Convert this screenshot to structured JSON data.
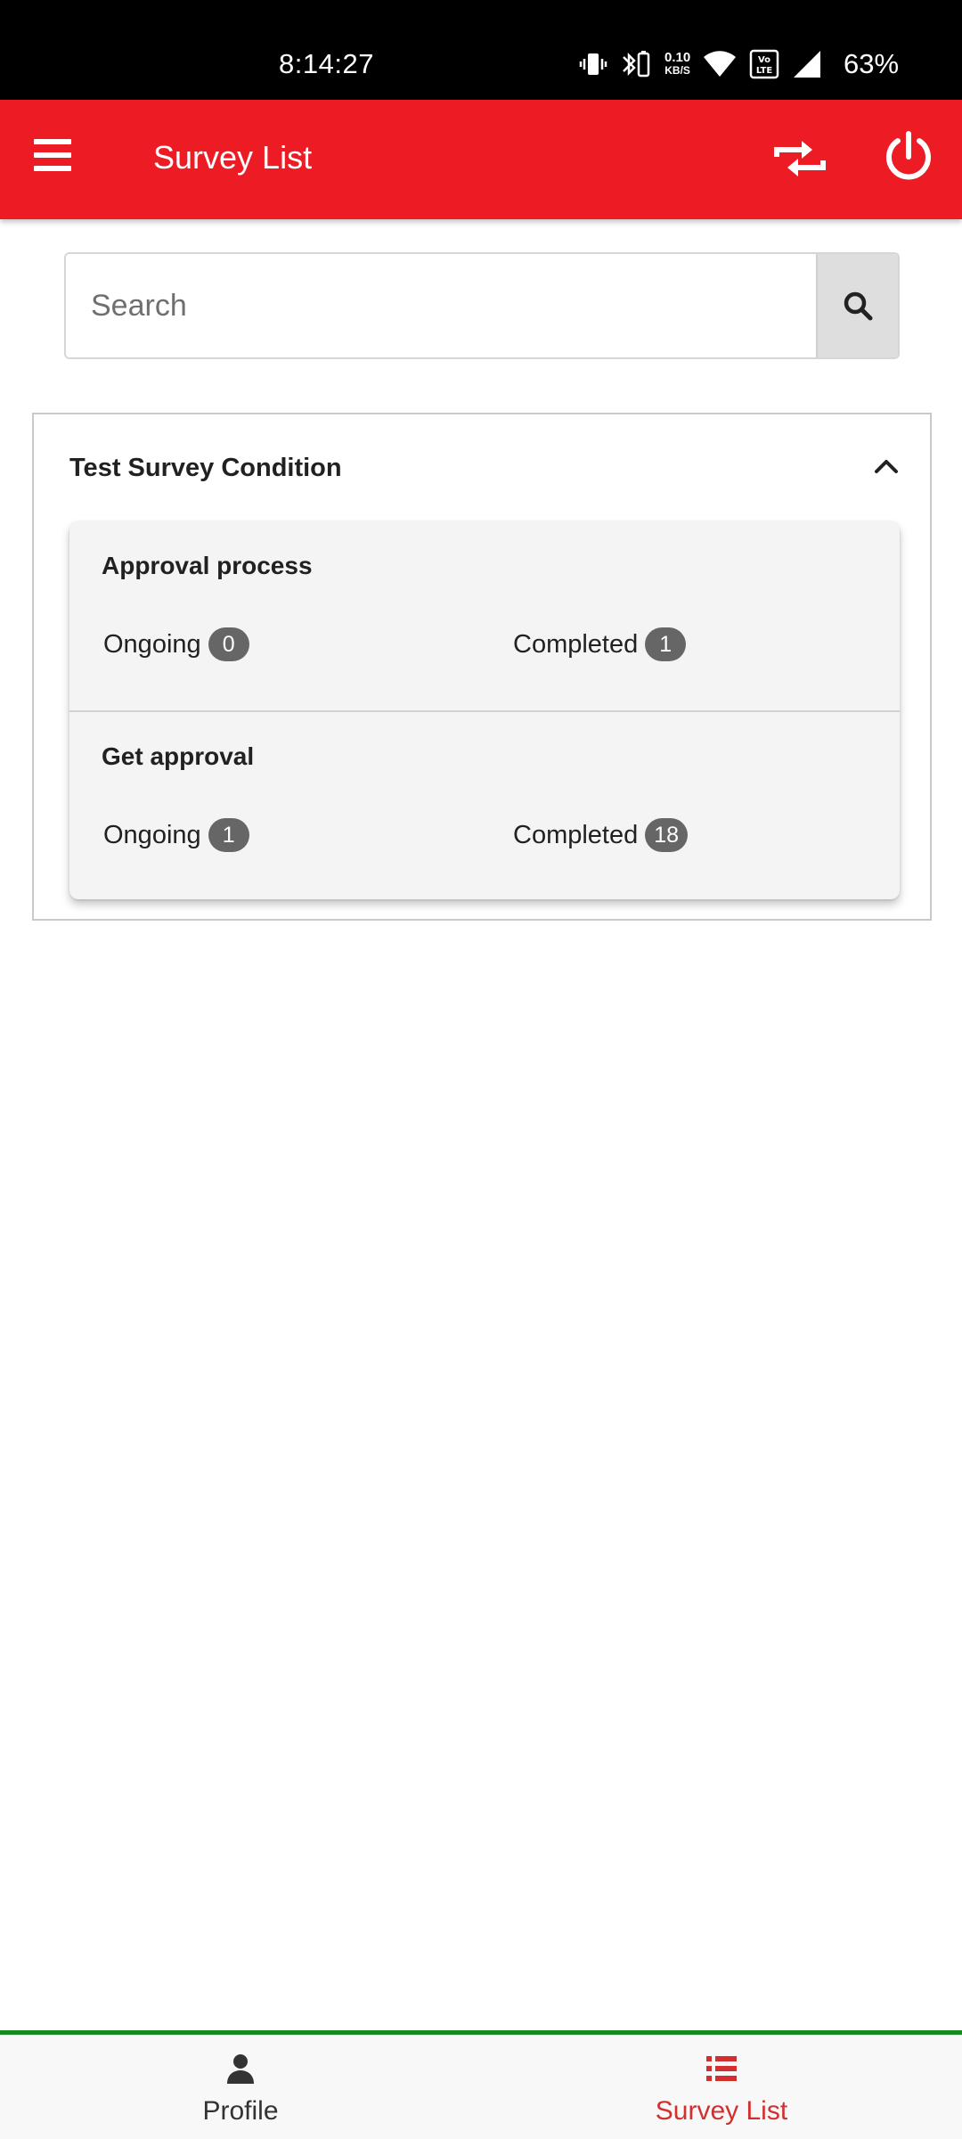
{
  "status_bar": {
    "time": "8:14:27",
    "net_speed_value": "0.10",
    "net_speed_unit": "KB/S",
    "battery": "63%",
    "icons": [
      "vibrate-icon",
      "bluetooth-battery-icon",
      "wifi-icon",
      "volte-icon",
      "signal-icon"
    ]
  },
  "app_bar": {
    "title": "Survey List",
    "menu_icon": "hamburger-menu-icon",
    "sync_icon": "sync-arrows-icon",
    "power_icon": "power-icon",
    "background": "#ed1c24"
  },
  "search": {
    "placeholder": "Search",
    "value": "",
    "icon": "search-icon"
  },
  "survey_group": {
    "title": "Test Survey Condition",
    "expanded": true,
    "surveys": [
      {
        "name": "Approval process",
        "ongoing_label": "Ongoing",
        "ongoing_count": "0",
        "completed_label": "Completed",
        "completed_count": "1"
      },
      {
        "name": "Get approval",
        "ongoing_label": "Ongoing",
        "ongoing_count": "1",
        "completed_label": "Completed",
        "completed_count": "18"
      }
    ]
  },
  "bottom_nav": {
    "items": [
      {
        "label": "Profile",
        "icon": "person-icon",
        "active": false
      },
      {
        "label": "Survey List",
        "icon": "list-icon",
        "active": true
      }
    ],
    "active_color": "#d32f2f",
    "border_color": "#158a1e"
  }
}
